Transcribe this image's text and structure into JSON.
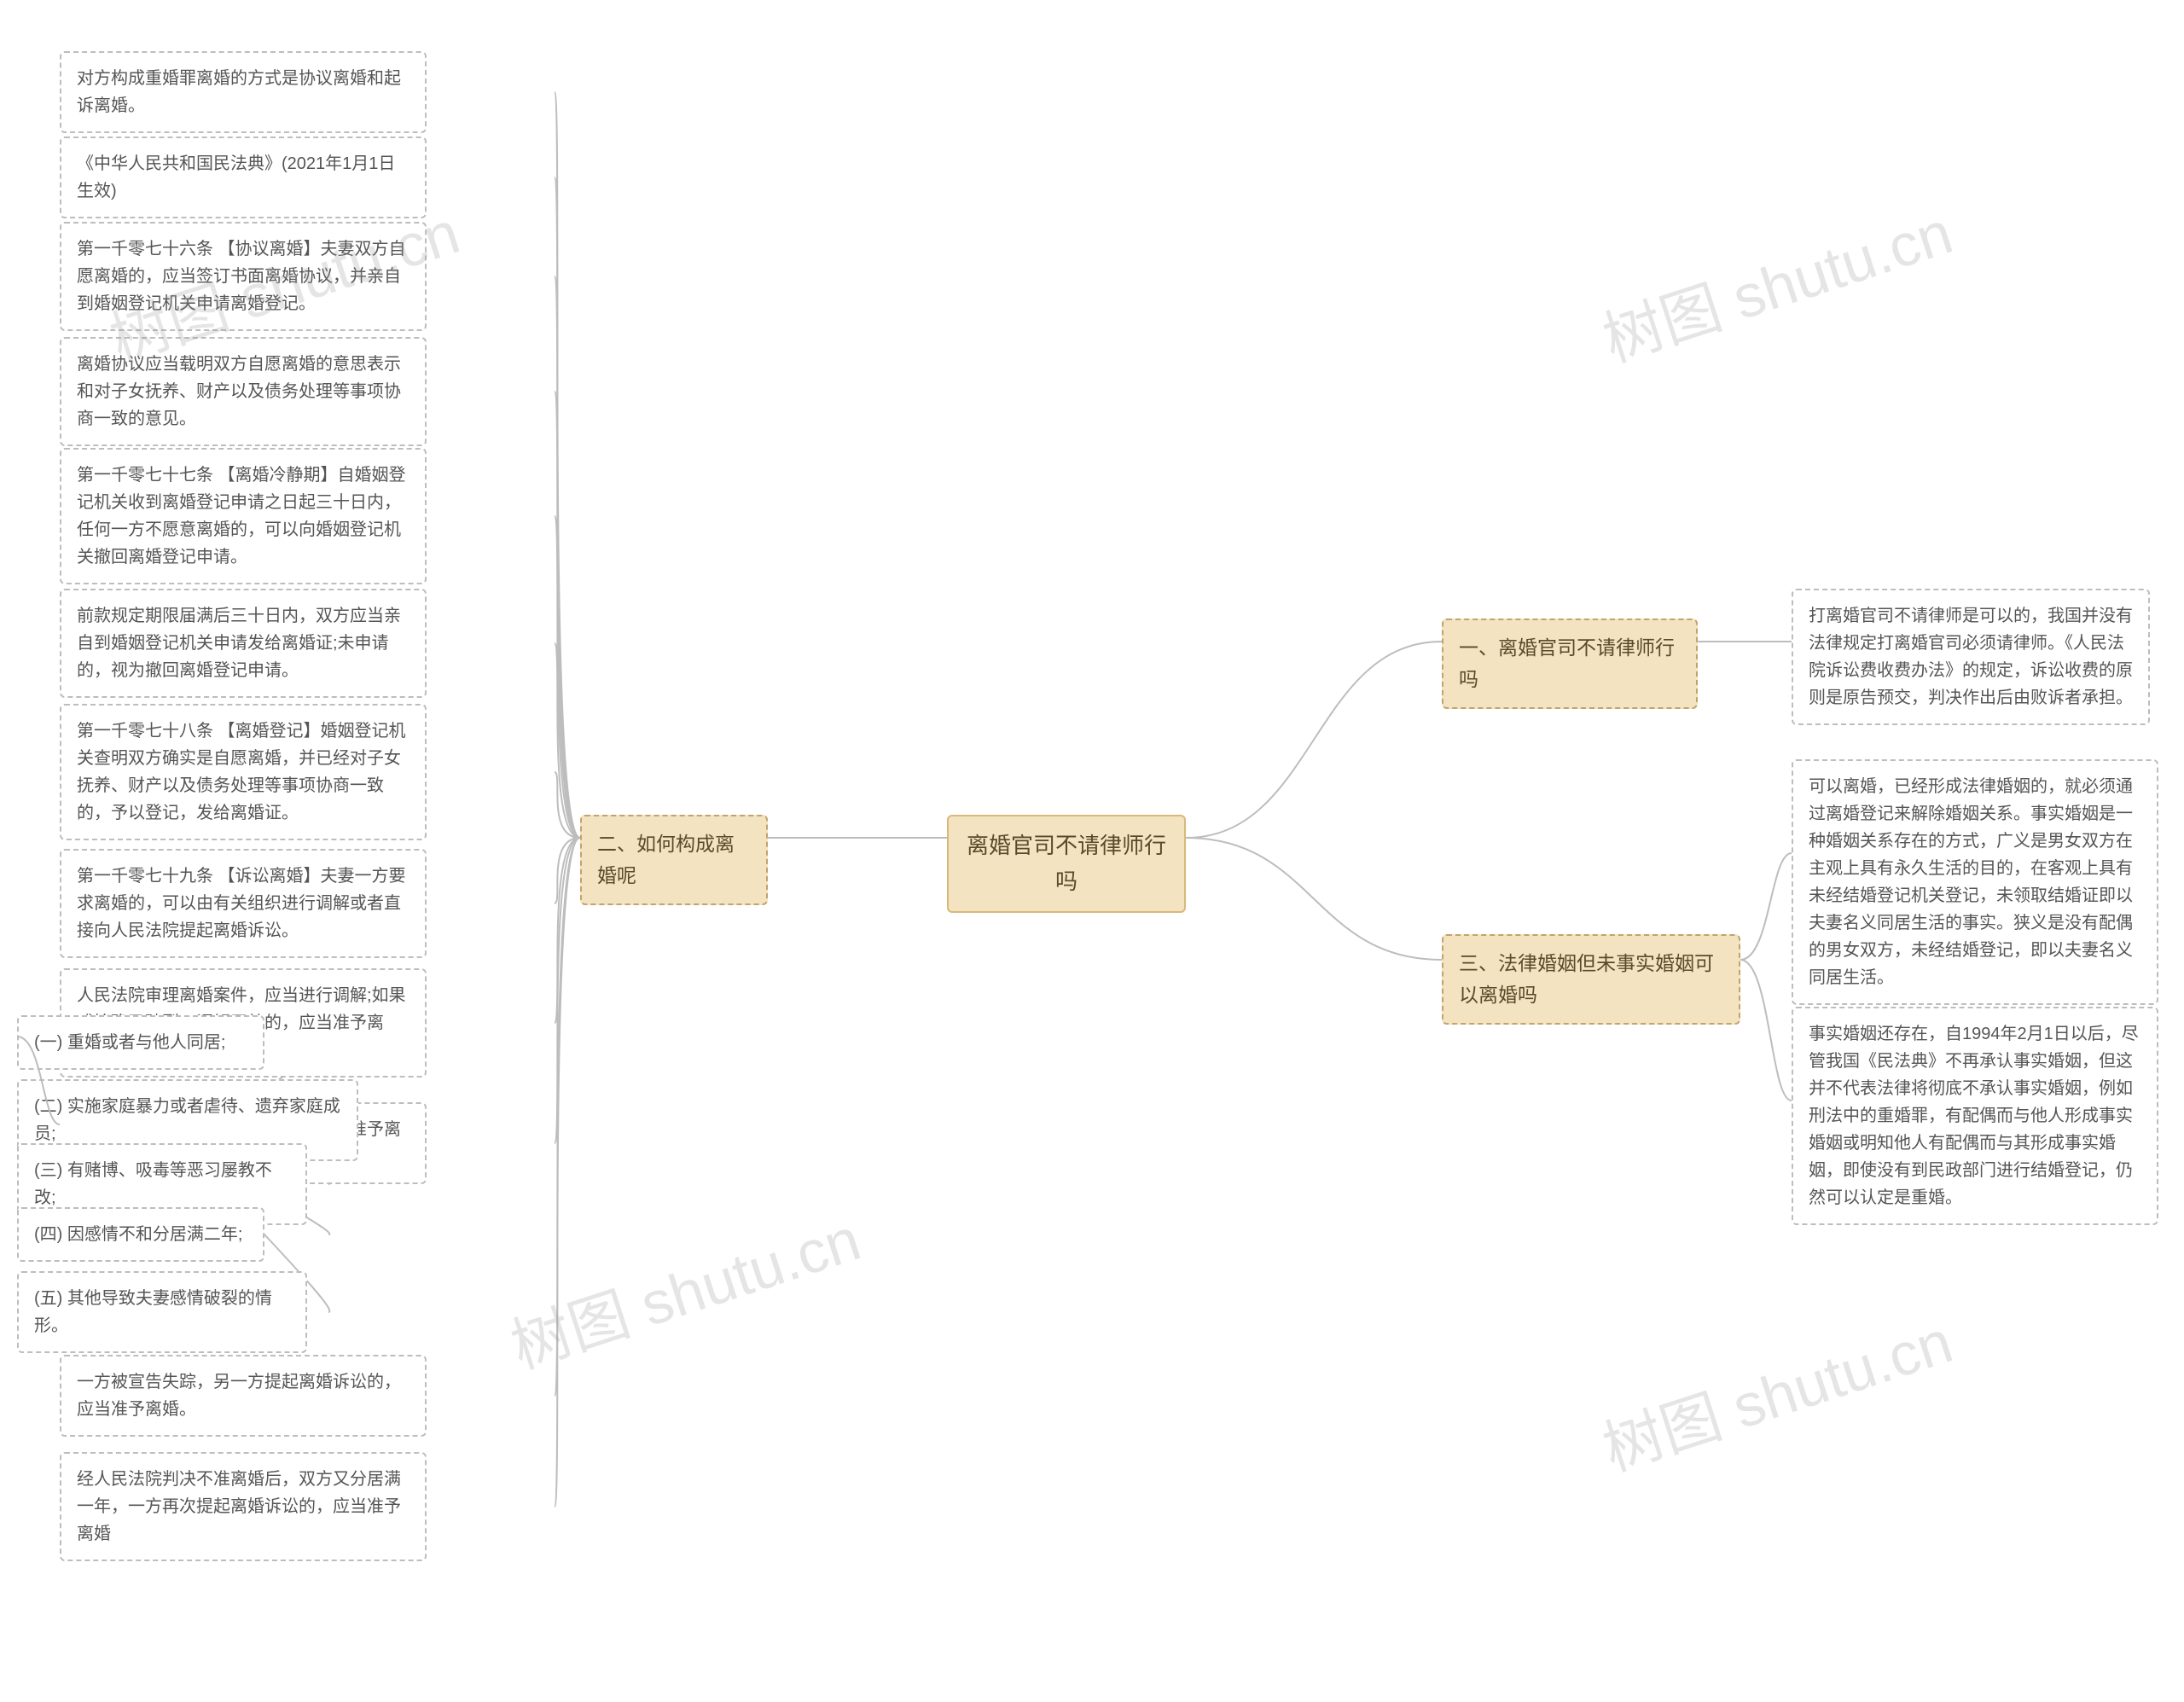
{
  "watermark": "树图 shutu.cn",
  "root": {
    "title": "离婚官司不请律师行吗"
  },
  "branch1": {
    "title": "一、离婚官司不请律师行吗",
    "leaf1": "打离婚官司不请律师是可以的，我国并没有法律规定打离婚官司必须请律师。《人民法院诉讼费收费办法》的规定，诉讼收费的原则是原告预交，判决作出后由败诉者承担。"
  },
  "branch2": {
    "title": "二、如何构成离婚呢",
    "leaf1": "对方构成重婚罪离婚的方式是协议离婚和起诉离婚。",
    "leaf2": "《中华人民共和国民法典》(2021年1月1日生效)",
    "leaf3": "第一千零七十六条 【协议离婚】夫妻双方自愿离婚的，应当签订书面离婚协议，并亲自到婚姻登记机关申请离婚登记。",
    "leaf4": "离婚协议应当载明双方自愿离婚的意思表示和对子女抚养、财产以及债务处理等事项协商一致的意见。",
    "leaf5": "第一千零七十七条 【离婚冷静期】自婚姻登记机关收到离婚登记申请之日起三十日内，任何一方不愿意离婚的，可以向婚姻登记机关撤回离婚登记申请。",
    "leaf6": "前款规定期限届满后三十日内，双方应当亲自到婚姻登记机关申请发给离婚证;未申请的，视为撤回离婚登记申请。",
    "leaf7": "第一千零七十八条 【离婚登记】婚姻登记机关查明双方确实是自愿离婚，并已经对子女抚养、财产以及债务处理等事项协商一致的，予以登记，发给离婚证。",
    "leaf8": "第一千零七十九条 【诉讼离婚】夫妻一方要求离婚的，可以由有关组织进行调解或者直接向人民法院提起离婚诉讼。",
    "leaf9": "人民法院审理离婚案件，应当进行调解;如果感情确已破裂，调解无效的，应当准予离婚。",
    "leaf10": {
      "text": "有下列情形之一，调解无效的，应当准予离婚:",
      "sub1": "(一) 重婚或者与他人同居;",
      "sub2": "(二) 实施家庭暴力或者虐待、遗弃家庭成员;",
      "sub3": "(三) 有赌博、吸毒等恶习屡教不改;",
      "sub4": "(四) 因感情不和分居满二年;",
      "sub5": "(五) 其他导致夫妻感情破裂的情形。"
    },
    "leaf11": "一方被宣告失踪，另一方提起离婚诉讼的，应当准予离婚。",
    "leaf12": "经人民法院判决不准离婚后，双方又分居满一年，一方再次提起离婚诉讼的，应当准予离婚"
  },
  "branch3": {
    "title": "三、法律婚姻但未事实婚姻可以离婚吗",
    "leaf1": "可以离婚，已经形成法律婚姻的，就必须通过离婚登记来解除婚姻关系。事实婚姻是一种婚姻关系存在的方式，广义是男女双方在主观上具有永久生活的目的，在客观上具有未经结婚登记机关登记，未领取结婚证即以夫妻名义同居生活的事实。狭义是没有配偶的男女双方，未经结婚登记，即以夫妻名义同居生活。",
    "leaf2": "事实婚姻还存在，自1994年2月1日以后，尽管我国《民法典》不再承认事实婚姻，但这并不代表法律将彻底不承认事实婚姻，例如刑法中的重婚罪，有配偶而与他人形成事实婚姻或明知他人有配偶而与其形成事实婚姻，即使没有到民政部门进行结婚登记，仍然可以认定是重婚。"
  }
}
